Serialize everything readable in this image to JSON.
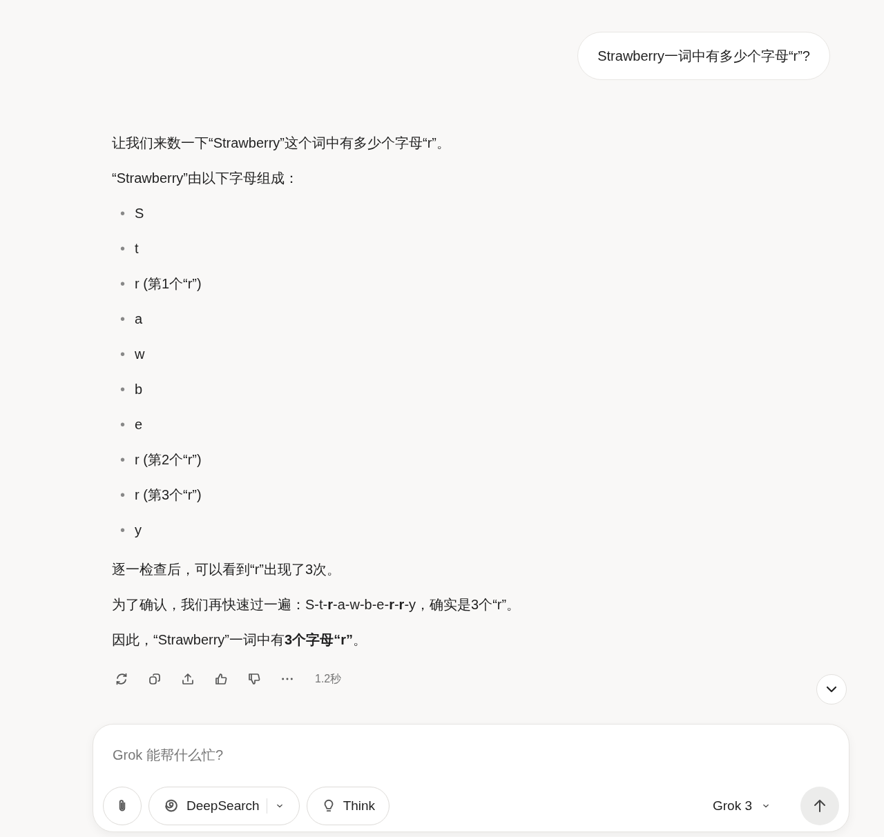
{
  "user_message": "Strawberry一词中有多少个字母“r”?",
  "answer": {
    "intro": [
      "让我们来数一下“Strawberry”这个词中有多少个字母“r”。",
      "“Strawberry”由以下字母组成："
    ],
    "letters": [
      {
        "marker": "•",
        "text": "S"
      },
      {
        "marker": "•",
        "text": "t"
      },
      {
        "marker": "•",
        "text": "r (第1个“r”)"
      },
      {
        "marker": "•",
        "text": "a"
      },
      {
        "marker": "•",
        "text": "w"
      },
      {
        "marker": "•",
        "text": "b"
      },
      {
        "marker": "•",
        "text": "e"
      },
      {
        "marker": "•",
        "text": "r (第2个“r”)"
      },
      {
        "marker": "•",
        "text": "r (第3个“r”)"
      },
      {
        "marker": "•",
        "text": "y"
      }
    ],
    "conclusion": [
      "逐一检查后，可以看到“r”出现了3次。",
      "为了确认，我们再快速过一遍：S-t-**r**-a-w-b-e-**r**-**r**-y，确实是3个“r”。",
      "因此，“Strawberry”一词中有**3个字母“r”**。"
    ]
  },
  "actions": [
    {
      "kind": "regenerate"
    },
    {
      "kind": "copy"
    },
    {
      "kind": "share"
    },
    {
      "kind": "like"
    },
    {
      "kind": "dislike"
    },
    {
      "kind": "more"
    }
  ],
  "duration": "1.2秒",
  "composer": {
    "placeholder": "Grok 能帮什么忙?",
    "tools": [
      {
        "kind": "attach"
      },
      {
        "kind": "deepsearch",
        "label": "DeepSearch"
      },
      {
        "kind": "think",
        "label": "Think"
      }
    ],
    "model": "Grok 3"
  }
}
